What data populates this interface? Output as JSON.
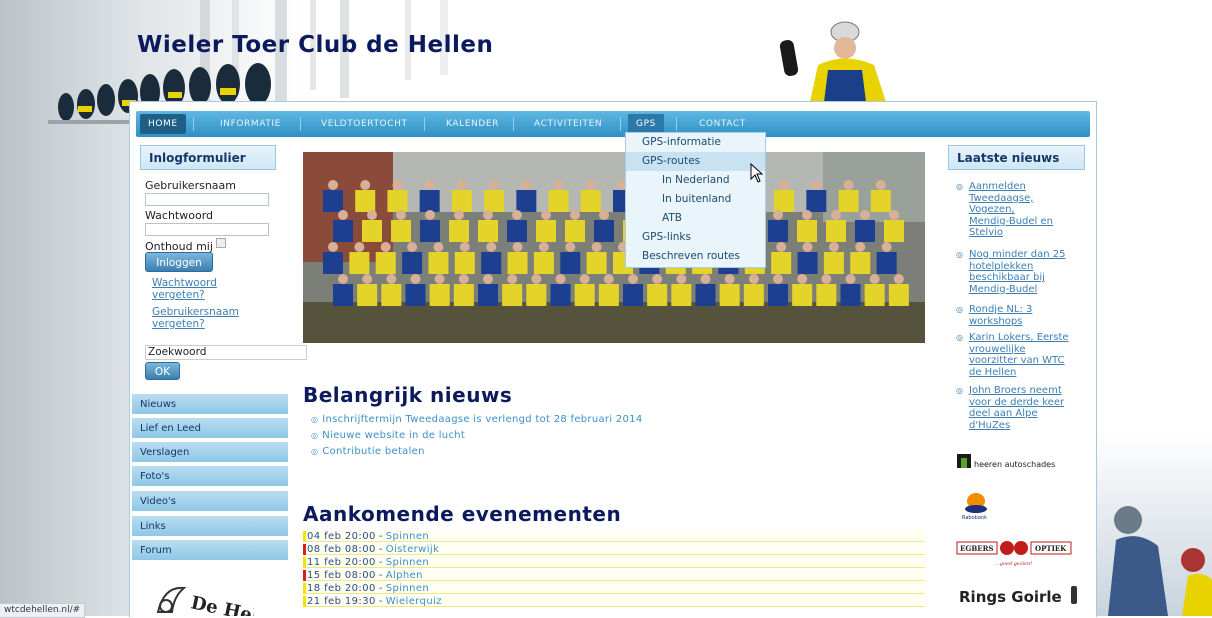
{
  "site": {
    "title": "Wieler Toer Club de Hellen"
  },
  "nav": {
    "items": [
      "HOME",
      "INFORMATIE",
      "VELDTOERTOCHT",
      "KALENDER",
      "ACTIVITEITEN",
      "GPS",
      "CONTACT"
    ],
    "active": "HOME",
    "open_menu": "GPS"
  },
  "gps_menu": {
    "items": [
      "GPS-informatie",
      "GPS-routes",
      "In Nederland",
      "In buitenland",
      "ATB",
      "GPS-links",
      "Beschreven routes"
    ],
    "highlighted": "GPS-routes"
  },
  "login": {
    "heading": "Inlogformulier",
    "username_label": "Gebruikersnaam",
    "password_label": "Wachtwoord",
    "remember_label": "Onthoud mij",
    "login_button": "Inloggen",
    "forgot_password": [
      "Wachtwoord",
      "vergeten?"
    ],
    "forgot_username": [
      "Gebruikersnaam",
      "vergeten?"
    ]
  },
  "search": {
    "value": "Zoekwoord",
    "button": "OK"
  },
  "sidebar": {
    "items": [
      "Nieuws",
      "Lief en Leed",
      "Verslagen",
      "Foto's",
      "Video's",
      "Links",
      "Forum"
    ]
  },
  "important_news": {
    "heading": "Belangrijk nieuws",
    "items": [
      "Inschrijftermijn Tweedaagse is verlengd tot 28 februari 2014",
      "Nieuwe website in de lucht",
      "Contributie betalen"
    ]
  },
  "events": {
    "heading": "Aankomende evenementen",
    "items": [
      {
        "date": "04 feb 20:00",
        "name": "Spinnen",
        "color": "#f2e600"
      },
      {
        "date": "08 feb 08:00",
        "name": "Oisterwijk",
        "color": "#d81e1e"
      },
      {
        "date": "11 feb 20:00",
        "name": "Spinnen",
        "color": "#f2e600"
      },
      {
        "date": "15 feb 08:00",
        "name": "Alphen",
        "color": "#d81e1e"
      },
      {
        "date": "18 feb 20:00",
        "name": "Spinnen",
        "color": "#f2e600"
      },
      {
        "date": "21 feb 19:30",
        "name": "Wielerquiz",
        "color": "#f2e600"
      }
    ],
    "separator": "-"
  },
  "latest_news": {
    "heading": "Laatste nieuws",
    "items": [
      [
        "Aanmelden",
        "Tweedaagse,",
        "Vogezen,",
        "Mendig-Budel en",
        "Stelvio"
      ],
      [
        "Nog minder dan 25",
        "hotelplekken",
        "beschikbaar bij",
        "Mendig-Budel"
      ],
      [
        "Rondje NL: 3",
        "workshops"
      ],
      [
        "Karin Lokers, Eerste",
        "vrouwelijke",
        "voorzitter van WTC",
        "de Hellen"
      ],
      [
        "John Broers neemt",
        "voor de derde keer",
        "deel aan Alpe",
        "d'HuZes"
      ]
    ]
  },
  "sponsors": {
    "heeren": "heeren autoschades",
    "rabobank": "Rabobank",
    "egbers": [
      "EGBERS",
      "OPTIEK",
      "...goed gezien!"
    ],
    "rings": "Rings Goirle"
  },
  "bottom_logo": "De Hel",
  "status_bar": "wtcdehellen.nl/#"
}
